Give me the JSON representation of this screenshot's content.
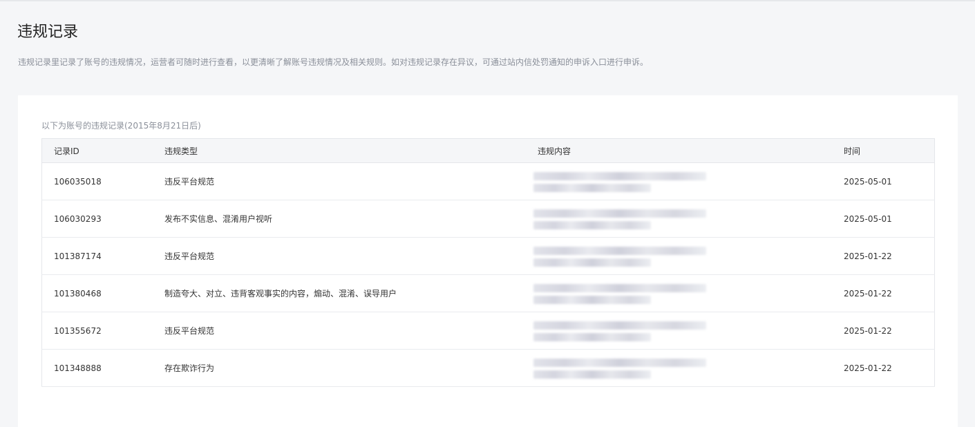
{
  "page": {
    "title": "违规记录",
    "description": "违规记录里记录了账号的违规情况，运营者可随时进行查看，以更清晰了解账号违规情况及相关规则。如对违规记录存在异议，可通过站内信处罚通知的申诉入口进行申诉。"
  },
  "table": {
    "caption": "以下为账号的违规记录(2015年8月21日后)",
    "columns": [
      "记录ID",
      "违规类型",
      "违规内容",
      "时间"
    ],
    "rows": [
      {
        "id": "106035018",
        "type": "违反平台规范",
        "time": "2025-05-01"
      },
      {
        "id": "106030293",
        "type": "发布不实信息、混淆用户视听",
        "time": "2025-05-01"
      },
      {
        "id": "101387174",
        "type": "违反平台规范",
        "time": "2025-01-22"
      },
      {
        "id": "101380468",
        "type": "制造夸大、对立、违背客观事实的内容，煽动、混淆、误导用户",
        "time": "2025-01-22"
      },
      {
        "id": "101355672",
        "type": "违反平台规范",
        "time": "2025-01-22"
      },
      {
        "id": "101348888",
        "type": "存在欺诈行为",
        "time": "2025-01-22"
      }
    ]
  }
}
